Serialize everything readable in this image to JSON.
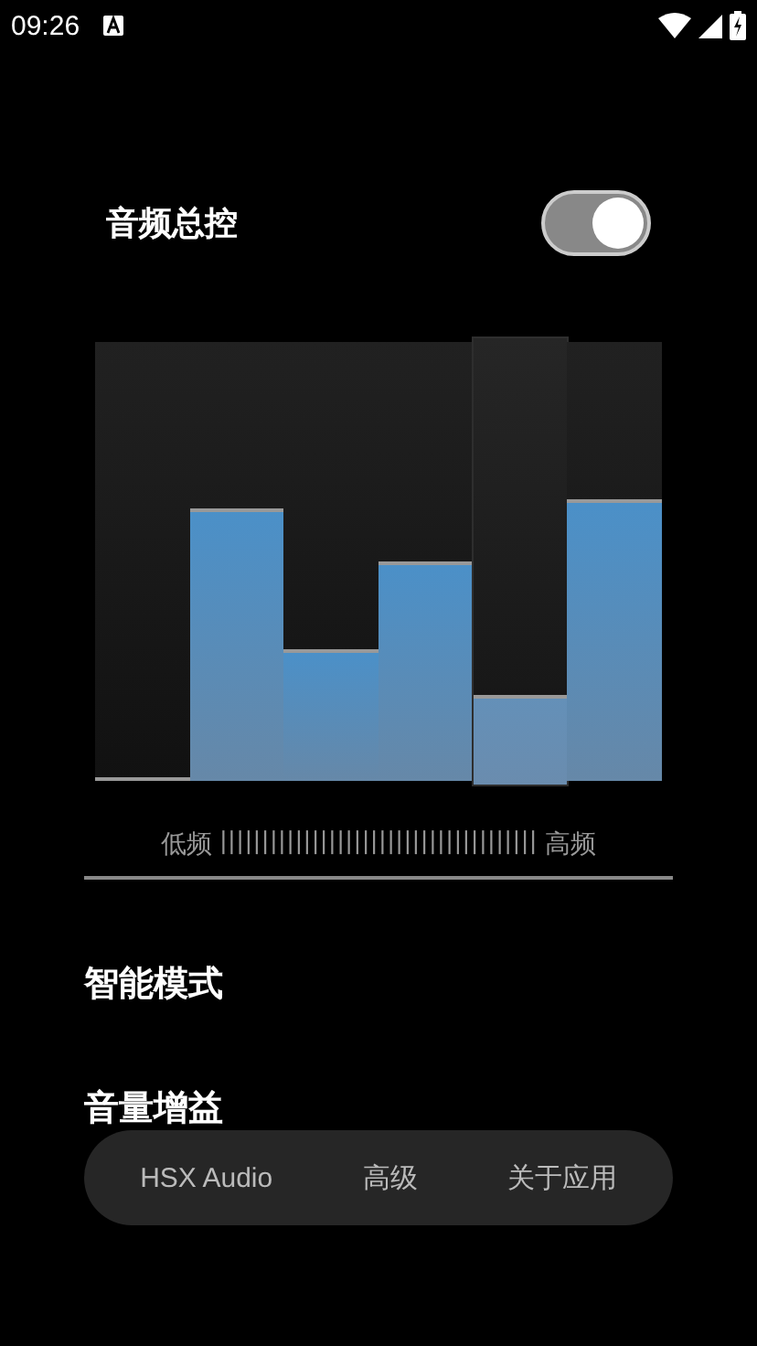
{
  "status_bar": {
    "time": "09:26"
  },
  "master": {
    "label": "音频总控",
    "on": true
  },
  "equalizer": {
    "bands": [
      {
        "level": 0.0,
        "selected": false
      },
      {
        "level": 0.62,
        "selected": false
      },
      {
        "level": 0.3,
        "selected": false
      },
      {
        "level": 0.5,
        "selected": false
      },
      {
        "level": 0.2,
        "selected": true
      },
      {
        "level": 0.64,
        "selected": false
      }
    ],
    "low_label": "低频",
    "scale": "||||||||||||||||||||||||||||||||||||||",
    "high_label": "高频"
  },
  "settings": [
    {
      "label": "智能模式"
    },
    {
      "label": "音量增益"
    }
  ],
  "nav": [
    {
      "label": "HSX Audio",
      "selected": false
    },
    {
      "label": "高级",
      "selected": false
    },
    {
      "label": "关于应用",
      "selected": false
    }
  ]
}
